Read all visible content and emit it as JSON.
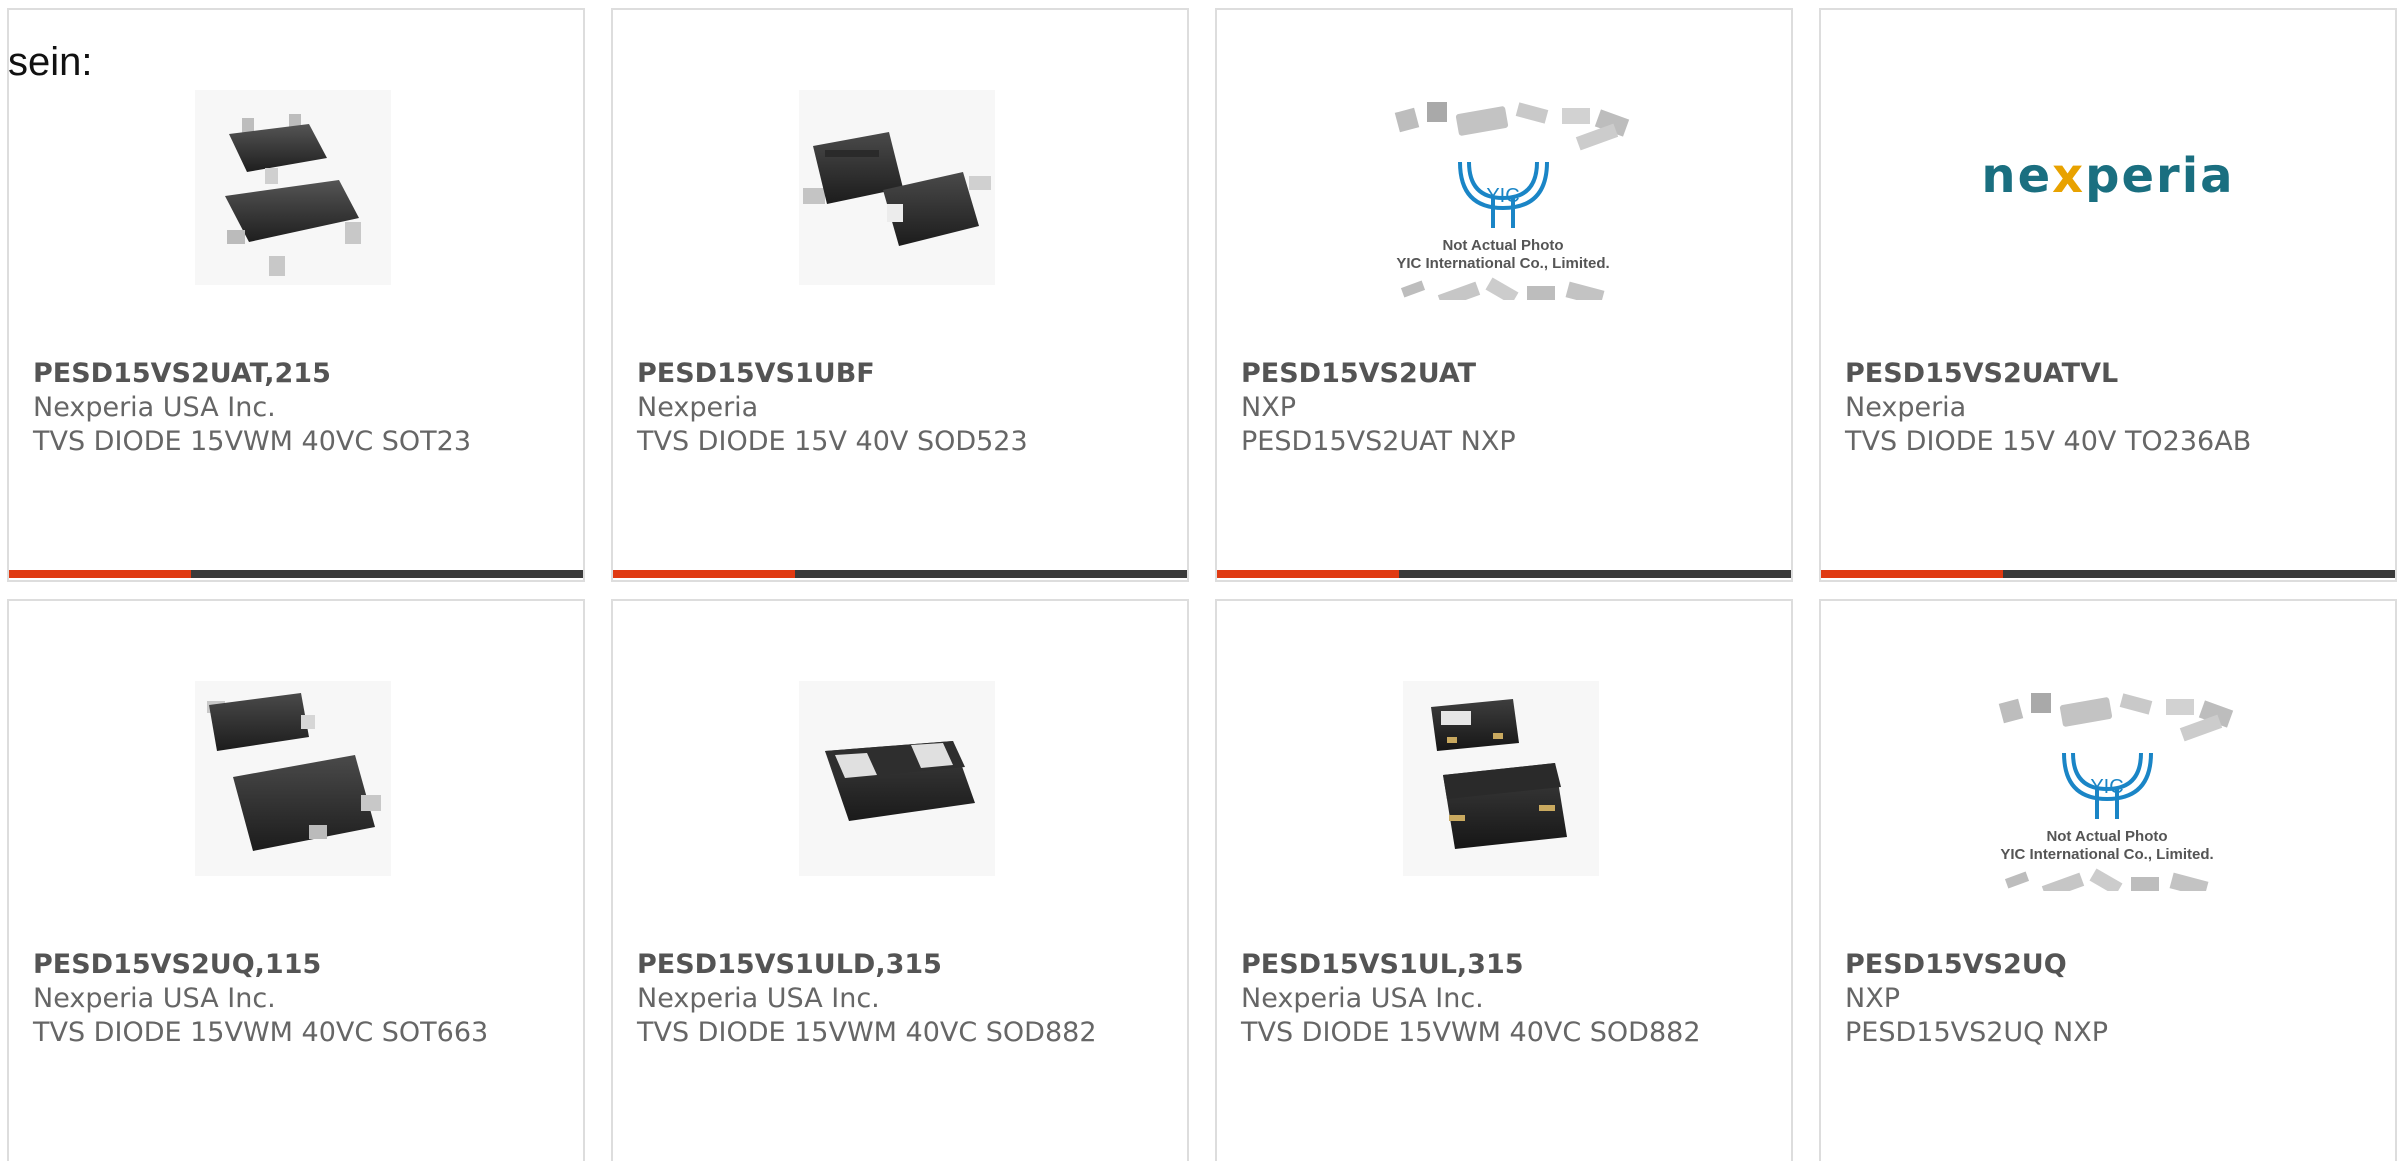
{
  "intro_text": "sein:",
  "products": [
    {
      "part": "PESD15VS2UAT,215",
      "manufacturer": "Nexperia USA Inc.",
      "description": "TVS DIODE 15VWM 40VC SOT23",
      "image": "sot23-package-photo"
    },
    {
      "part": "PESD15VS1UBF",
      "manufacturer": "Nexperia",
      "description": "TVS DIODE 15V 40V SOD523",
      "image": "sod523-package-photo"
    },
    {
      "part": "PESD15VS2UAT",
      "manufacturer": "NXP",
      "description": "PESD15VS2UAT NXP",
      "image": "yic-placeholder-photo"
    },
    {
      "part": "PESD15VS2UATVL",
      "manufacturer": "Nexperia",
      "description": "TVS DIODE 15V 40V TO236AB",
      "image": "nexperia-logo"
    },
    {
      "part": "PESD15VS2UQ,115",
      "manufacturer": "Nexperia USA Inc.",
      "description": "TVS DIODE 15VWM 40VC SOT663",
      "image": "sot663-package-photo"
    },
    {
      "part": "PESD15VS1ULD,315",
      "manufacturer": "Nexperia USA Inc.",
      "description": "TVS DIODE 15VWM 40VC SOD882",
      "image": "sod882d-package-photo"
    },
    {
      "part": "PESD15VS1UL,315",
      "manufacturer": "Nexperia USA Inc.",
      "description": "TVS DIODE 15VWM 40VC SOD882",
      "image": "sod882-package-photo"
    },
    {
      "part": "PESD15VS2UQ",
      "manufacturer": "NXP",
      "description": "PESD15VS2UQ NXP",
      "image": "yic-placeholder-photo"
    }
  ],
  "placeholder": {
    "brand": "YIC",
    "line1": "Not Actual Photo",
    "line2": "YIC International Co., Limited."
  },
  "logo": {
    "text_pre": "ne",
    "text_x": "x",
    "text_post": "peria"
  },
  "colors": {
    "accent": "#e03a12",
    "bar": "#3a3a3a",
    "border": "#dddddd",
    "part_text": "#545454",
    "body_text": "#666666",
    "logo_teal": "#1a6f80",
    "logo_x": "#e8a200",
    "yic_blue": "#1a85c6"
  }
}
